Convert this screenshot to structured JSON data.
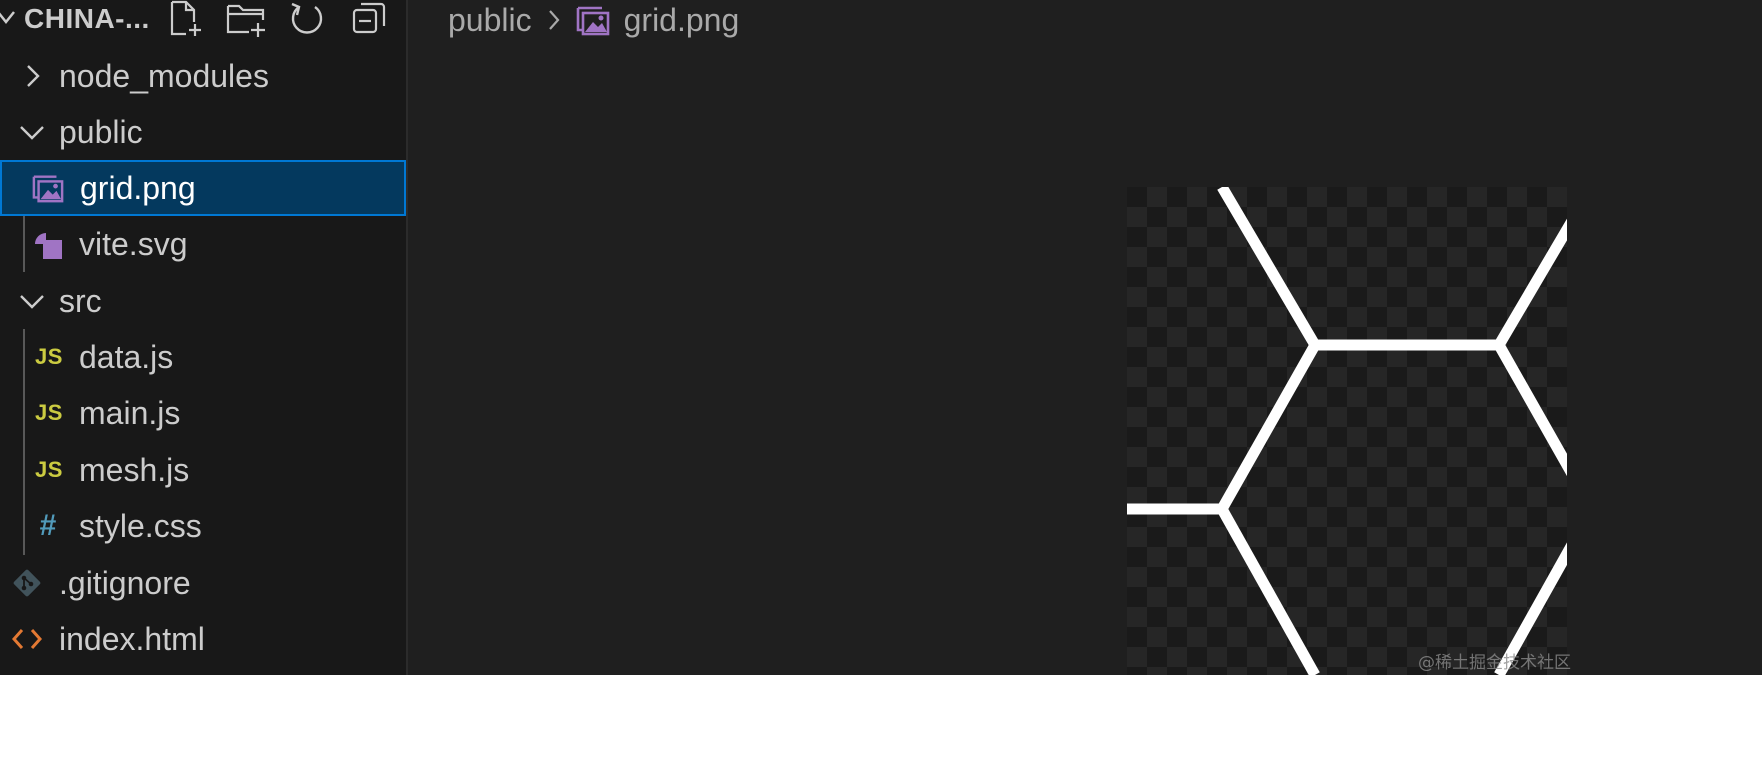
{
  "explorer": {
    "project_title": "CHINA-...",
    "toolbar": [
      {
        "name": "new-file-icon"
      },
      {
        "name": "new-folder-icon"
      },
      {
        "name": "refresh-icon"
      },
      {
        "name": "collapse-all-icon"
      }
    ],
    "tree": [
      {
        "label": "node_modules",
        "type": "folder",
        "expanded": false,
        "icon": "chevron-right-icon"
      },
      {
        "label": "public",
        "type": "folder",
        "expanded": true,
        "icon": "chevron-down-icon"
      },
      {
        "label": "grid.png",
        "type": "file",
        "icon": "image-file-icon",
        "selected": true
      },
      {
        "label": "vite.svg",
        "type": "file",
        "icon": "svg-file-icon"
      },
      {
        "label": "src",
        "type": "folder",
        "expanded": true,
        "icon": "chevron-down-icon"
      },
      {
        "label": "data.js",
        "type": "file",
        "icon": "js-file-icon",
        "glyph": "JS"
      },
      {
        "label": "main.js",
        "type": "file",
        "icon": "js-file-icon",
        "glyph": "JS"
      },
      {
        "label": "mesh.js",
        "type": "file",
        "icon": "js-file-icon",
        "glyph": "JS"
      },
      {
        "label": "style.css",
        "type": "file",
        "icon": "css-file-icon",
        "glyph": "#"
      },
      {
        "label": ".gitignore",
        "type": "file",
        "icon": "git-file-icon"
      },
      {
        "label": "index.html",
        "type": "file",
        "icon": "html-file-icon"
      }
    ]
  },
  "editor": {
    "breadcrumb": {
      "folder": "public",
      "file": "grid.png"
    },
    "preview": {
      "description_icon": "hexagon-grid-image",
      "line_color": "#ffffff"
    }
  },
  "colors": {
    "selection_bg": "#04395e",
    "selection_border": "#0078d4",
    "image_icon": "#a074c4",
    "js_icon": "#cbcb41",
    "css_icon": "#519aba",
    "html_icon": "#e37933"
  },
  "watermark": "@稀土掘金技术社区"
}
